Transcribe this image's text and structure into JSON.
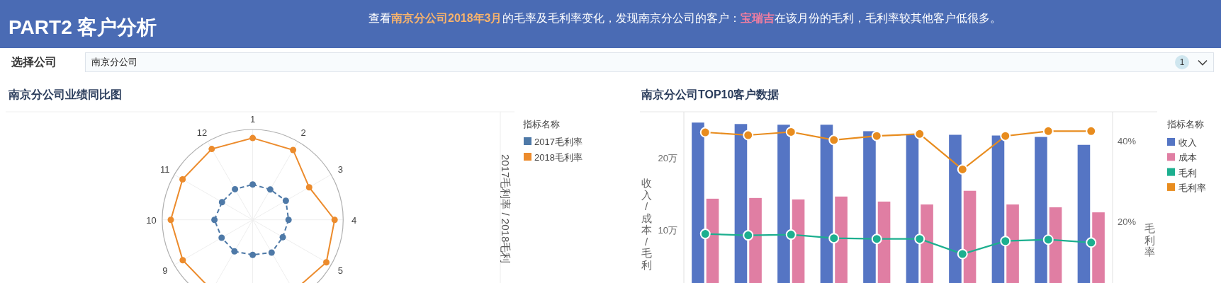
{
  "header": {
    "title": "PART2 客户分析",
    "message": [
      {
        "text": "查看"
      },
      {
        "text": "南京分公司2018年3月",
        "color": "#f8b36c"
      },
      {
        "text": "的毛率及毛利率变化，发现南京分公司的客户："
      },
      {
        "text": "宝瑞吉",
        "color": "#f57ea0"
      },
      {
        "text": "在该月份的毛利，毛利率较其他客户低很多。"
      }
    ]
  },
  "filter": {
    "label": "选择公司",
    "value": "南京分公司",
    "count": "1"
  },
  "radar_panel": {
    "title": "南京分公司业绩同比图",
    "axis_labels": [
      "1",
      "2",
      "3",
      "4",
      "5",
      "9",
      "10",
      "11",
      "12"
    ],
    "axis_title": "2017毛利率 / 2018毛利",
    "legend_title": "指标名称",
    "legend": [
      {
        "label": "2017毛利率",
        "color": "#4e79a7"
      },
      {
        "label": "2018毛利率",
        "color": "#ec8b2c"
      }
    ]
  },
  "bar_panel": {
    "title": "南京分公司TOP10客户数据",
    "legend_title": "指标名称",
    "left_axis_title": "收入/成本/毛利",
    "right_axis_title": "毛利率",
    "left_ticks": [
      "20万",
      "10万"
    ],
    "right_ticks": [
      "40%",
      "20%"
    ],
    "legend": [
      {
        "label": "收入",
        "color": "#5575c4",
        "kind": "bar"
      },
      {
        "label": "成本",
        "color": "#e07ea3",
        "kind": "bar"
      },
      {
        "label": "毛利",
        "color": "#1caf8f",
        "kind": "line"
      },
      {
        "label": "毛利率",
        "color": "#e88c1e",
        "kind": "line"
      }
    ]
  }
}
